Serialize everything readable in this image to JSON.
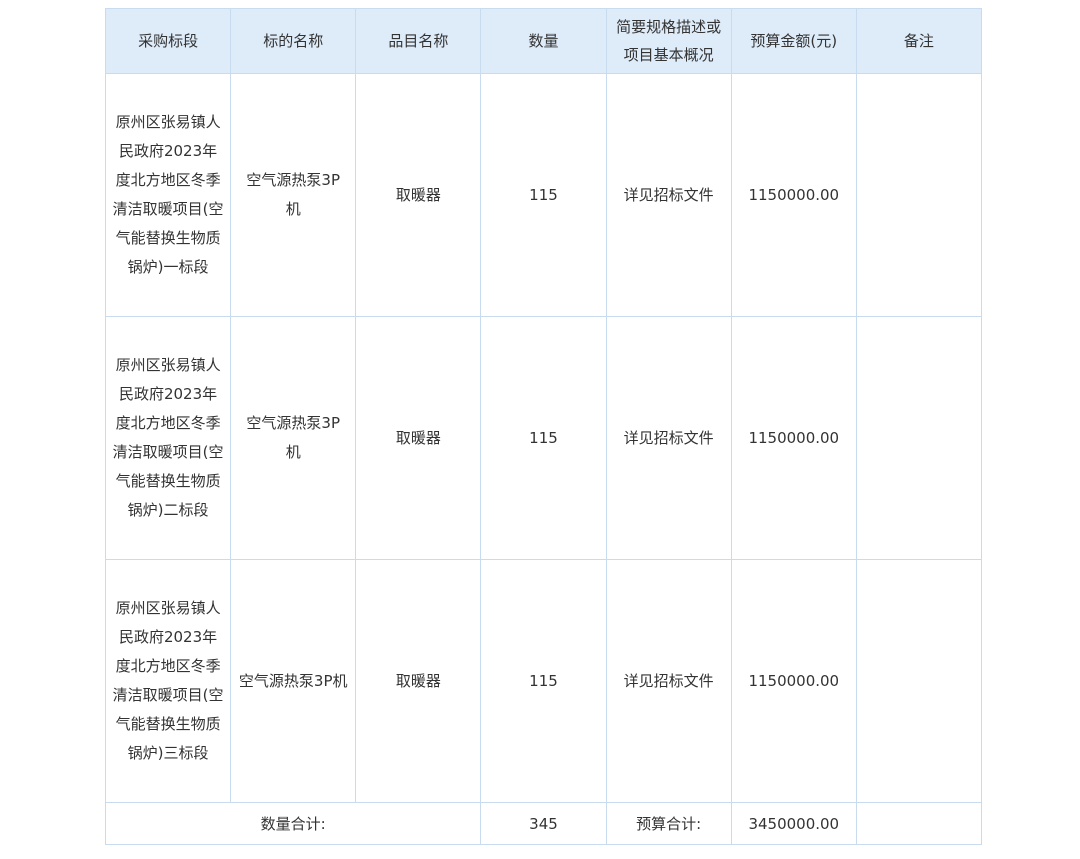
{
  "headers": [
    "采购标段",
    "标的名称",
    "品目名称",
    "数量",
    "简要规格描述或项目基本概况",
    "预算金额(元)",
    "备注"
  ],
  "rows": [
    {
      "segment": "原州区张易镇人民政府2023年度北方地区冬季清洁取暖项目(空气能替换生物质锅炉)一标段",
      "subject": "空气源热泵3P 机",
      "category": "取暖器",
      "quantity": "115",
      "spec": "详见招标文件",
      "budget": "1150000.00",
      "remark": ""
    },
    {
      "segment": "原州区张易镇人民政府2023年度北方地区冬季清洁取暖项目(空气能替换生物质锅炉)二标段",
      "subject": "空气源热泵3P 机",
      "category": "取暖器",
      "quantity": "115",
      "spec": "详见招标文件",
      "budget": "1150000.00",
      "remark": ""
    },
    {
      "segment": "原州区张易镇人民政府2023年度北方地区冬季清洁取暖项目(空气能替换生物质锅炉)三标段",
      "subject": "空气源热泵3P机",
      "category": "取暖器",
      "quantity": "115",
      "spec": "详见招标文件",
      "budget": "1150000.00",
      "remark": ""
    }
  ],
  "summary": {
    "quantity_label": "数量合计:",
    "quantity_total": "345",
    "budget_label": "预算合计:",
    "budget_total": "3450000.00"
  }
}
